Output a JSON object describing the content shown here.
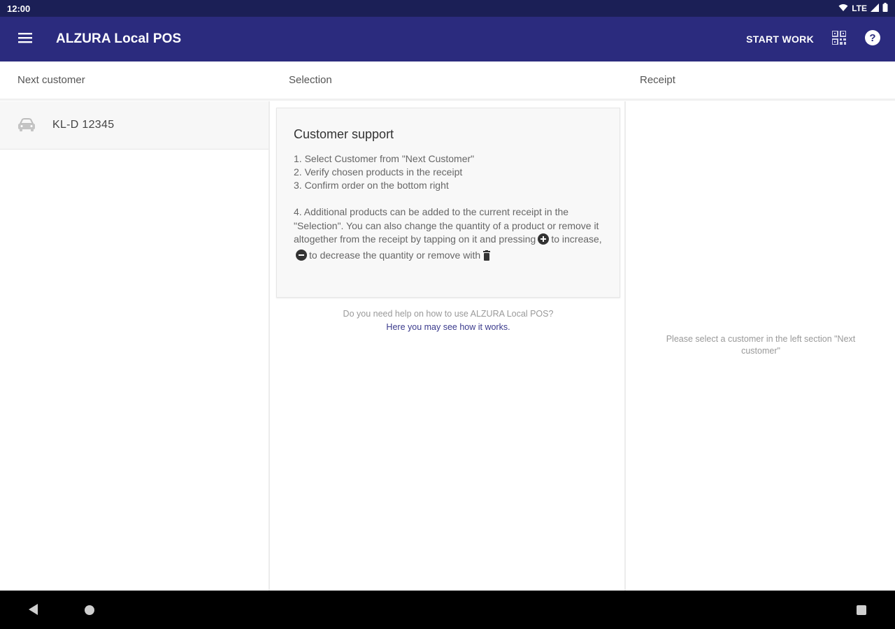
{
  "status_bar": {
    "time": "12:00",
    "network": "LTE",
    "icons": [
      "wifi-icon",
      "signal-icon",
      "battery-icon"
    ]
  },
  "app_bar": {
    "title": "ALZURA Local POS",
    "start_work_label": "START WORK",
    "icons": [
      "menu-icon",
      "qr-code-icon",
      "help-icon"
    ]
  },
  "columns": {
    "next_customer_header": "Next customer",
    "selection_header": "Selection",
    "receipt_header": "Receipt"
  },
  "customers": [
    {
      "plate": "KL-D 12345",
      "icon": "car-icon"
    }
  ],
  "support": {
    "title": "Customer support",
    "steps": [
      "1. Select Customer from \"Next Customer\"",
      "2. Verify chosen products in the receipt",
      "3. Confirm order on the bottom right"
    ],
    "step4_part1": "4. Additional products can be added to the current receipt in the \"Selection\". You can also change the quantity of a product or remove it altogether from the receipt by tapping on it and pressing",
    "step4_part2": "to increase,",
    "step4_part3": "to decrease the quantity or remove with"
  },
  "help": {
    "question": "Do you need help on how to use ALZURA Local POS?",
    "link": "Here you may see how it works."
  },
  "receipt": {
    "hint": "Please select a customer in the left section \"Next customer\""
  },
  "colors": {
    "status_bar": "#1b1f56",
    "app_bar": "#2b2b7e",
    "link": "#3a3a8c"
  }
}
